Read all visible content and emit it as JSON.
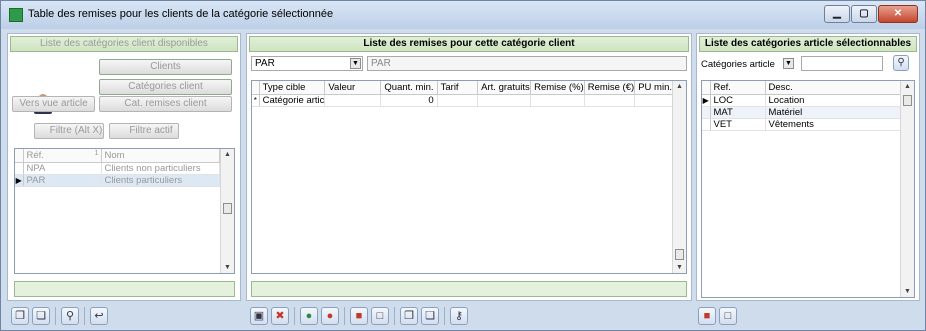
{
  "window": {
    "title": "Table des remises pour les clients de la catégorie sélectionnée",
    "buttons": {
      "minimize": "▁",
      "maximize": "▢",
      "close": "✕"
    }
  },
  "left_panel": {
    "header": "Liste des catégories client disponibles",
    "buttons": {
      "clients": "Clients",
      "categories_client": "Catégories client",
      "vers_vue_article": "Vers vue article",
      "cat_remises_client": "Cat. remises client",
      "filtre": "Filtre (Alt X)",
      "filtre_actif": "Filtre actif"
    },
    "grid": {
      "columns": [
        "Réf.",
        "Nom"
      ],
      "sort_indicator": "1",
      "rows": [
        {
          "ref": "NPA",
          "nom": "Clients non particuliers"
        },
        {
          "ref": "PAR",
          "nom": "Clients particuliers"
        }
      ],
      "current_row_marker": "▶"
    }
  },
  "middle_panel": {
    "header": "Liste des remises pour cette catégorie client",
    "category_code": "PAR",
    "category_label": "PAR",
    "grid": {
      "columns": [
        "Type cible",
        "Valeur",
        "Quant. min.",
        "Tarif",
        "Art. gratuits",
        "Remise (%)",
        "Remise (€)",
        "PU min."
      ],
      "new_row": {
        "marker": "*",
        "type_cible": "Catégorie artic",
        "quant_min": "0"
      }
    }
  },
  "right_panel": {
    "header": "Liste des catégories article sélectionnables",
    "filter_label": "Catégories article",
    "search_value": "",
    "grid": {
      "columns": [
        "Ref.",
        "Desc."
      ],
      "current_row_marker": "▶",
      "rows": [
        {
          "ref": "LOC",
          "desc": "Location"
        },
        {
          "ref": "MAT",
          "desc": "Matériel"
        },
        {
          "ref": "VET",
          "desc": "Vêtements"
        }
      ]
    }
  },
  "toolbar_icons": {
    "save": "💾",
    "cancel": "✖",
    "add": "➕",
    "remove": "➖",
    "pin": "⚲",
    "key": "⚷"
  }
}
